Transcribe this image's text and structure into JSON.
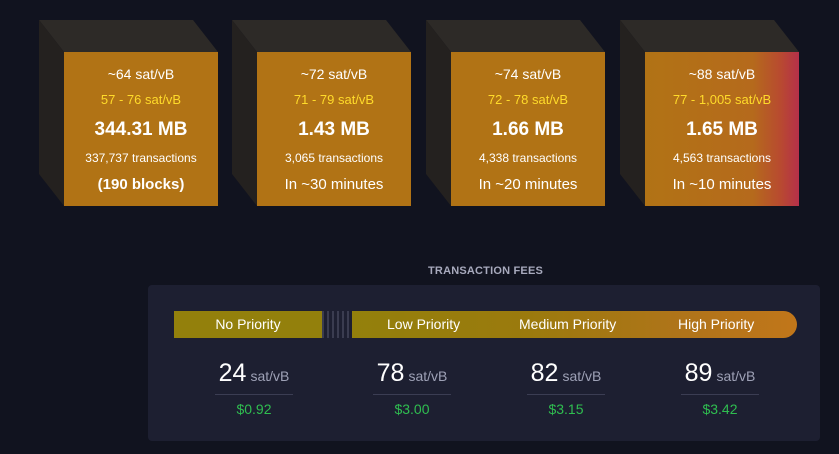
{
  "mempool_blocks": [
    {
      "fee_median": "~64 sat/vB",
      "fee_range": "57 - 76 sat/vB",
      "size": "344.31 MB",
      "transactions": "337,737 transactions",
      "eta": "(190 blocks)"
    },
    {
      "fee_median": "~72 sat/vB",
      "fee_range": "71 - 79 sat/vB",
      "size": "1.43 MB",
      "transactions": "3,065 transactions",
      "eta": "In ~30 minutes"
    },
    {
      "fee_median": "~74 sat/vB",
      "fee_range": "72 - 78 sat/vB",
      "size": "1.66 MB",
      "transactions": "4,338 transactions",
      "eta": "In ~20 minutes"
    },
    {
      "fee_median": "~88 sat/vB",
      "fee_range": "77 - 1,005 sat/vB",
      "size": "1.65 MB",
      "transactions": "4,563 transactions",
      "eta": "In ~10 minutes"
    }
  ],
  "fees": {
    "title": "TRANSACTION FEES",
    "priorities": [
      {
        "label": "No Priority",
        "rate": "24",
        "unit": "sat/vB",
        "usd": "$0.92"
      },
      {
        "label": "Low Priority",
        "rate": "78",
        "unit": "sat/vB",
        "usd": "$3.00"
      },
      {
        "label": "Medium Priority",
        "rate": "82",
        "unit": "sat/vB",
        "usd": "$3.15"
      },
      {
        "label": "High Priority",
        "rate": "89",
        "unit": "sat/vB",
        "usd": "$3.42"
      }
    ]
  },
  "colors": {
    "block_face": "#b17315",
    "fee_range": "#ffdb2a",
    "usd": "#2fbd50",
    "background": "#11131f"
  }
}
